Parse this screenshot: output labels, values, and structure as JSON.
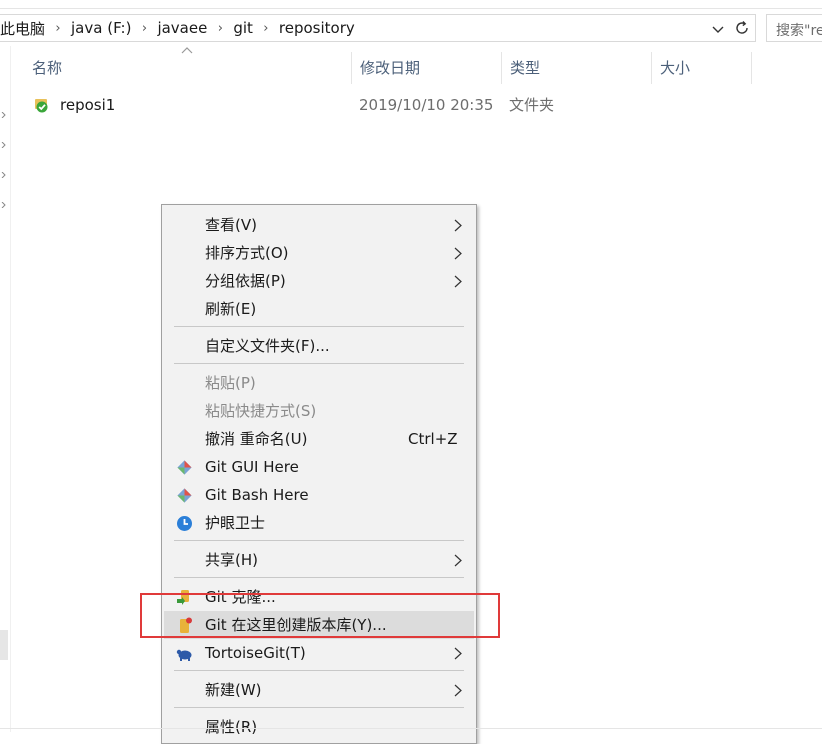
{
  "address_bar": {
    "crumbs": [
      "此电脑",
      "java (F:)",
      "javaee",
      "git",
      "repository"
    ],
    "search_placeholder": "搜索\"re"
  },
  "columns": [
    "名称",
    "修改日期",
    "类型",
    "大小"
  ],
  "files": [
    {
      "name": "reposi1",
      "date": "2019/10/10 20:35",
      "type": "文件夹",
      "icon": "tortoisegit-folder-clean-icon"
    }
  ],
  "menu": {
    "items": {
      "view": "查看(V)",
      "sort": "排序方式(O)",
      "group": "分组依据(P)",
      "refresh": "刷新(E)",
      "customize": "自定义文件夹(F)...",
      "paste": "粘贴(P)",
      "paste_shortcut": "粘贴快捷方式(S)",
      "undo": "撤消 重命名(U)",
      "undo_shortcut": "Ctrl+Z",
      "git_gui": "Git GUI Here",
      "git_bash": "Git Bash Here",
      "eye_guard": "护眼卫士",
      "share": "共享(H)",
      "git_clone": "Git 克隆...",
      "git_create_repo": "Git 在这里创建版本库(Y)...",
      "tortoisegit": "TortoiseGit(T)",
      "new": "新建(W)",
      "properties": "属性(R)"
    }
  },
  "colors": {
    "highlight_box": "#e03a3a",
    "menu_bg": "#f2f2f2",
    "column_header_text": "#4c607a"
  }
}
